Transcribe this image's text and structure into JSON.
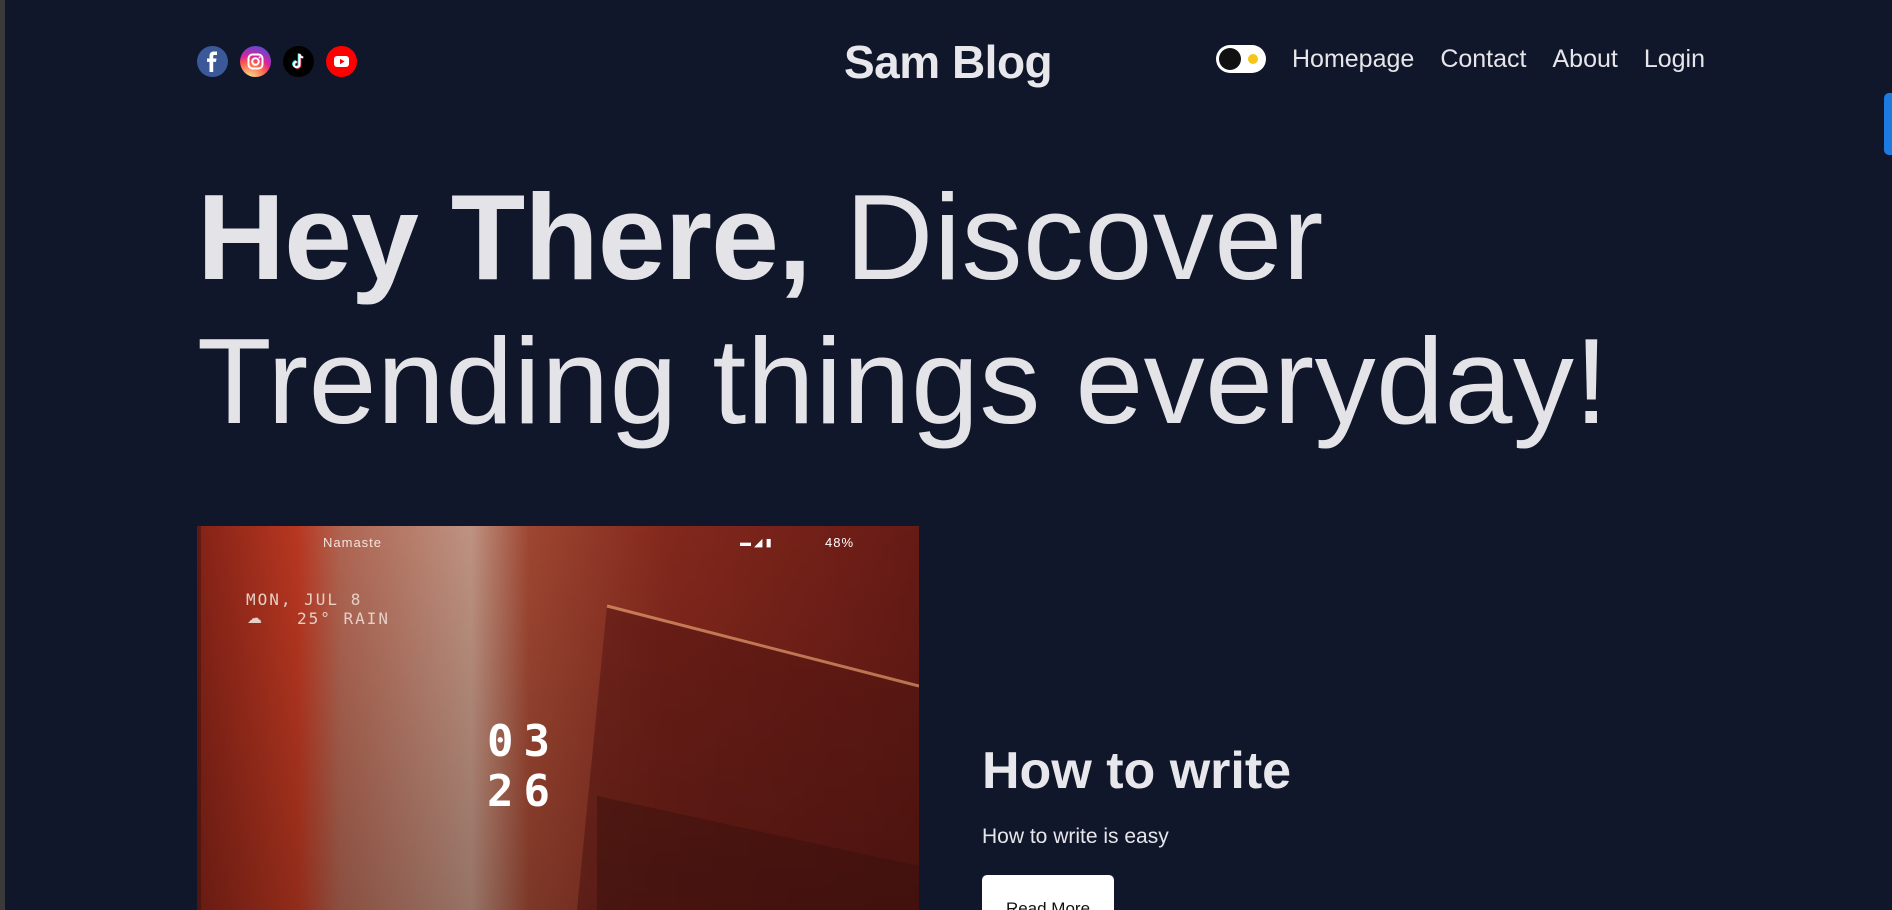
{
  "brand": {
    "title": "Sam Blog"
  },
  "socials": [
    {
      "name": "facebook-icon",
      "color": "#3b5998"
    },
    {
      "name": "instagram-icon",
      "color": "#d6249f"
    },
    {
      "name": "tiktok-icon",
      "color": "#000000"
    },
    {
      "name": "youtube-icon",
      "color": "#ff0000"
    }
  ],
  "nav": {
    "theme_toggle_icon": "sun-icon",
    "links": [
      "Homepage",
      "Contact",
      "About",
      "Login"
    ]
  },
  "hero": {
    "bold": "Hey There,",
    "light": "Discover Trending things everyday!"
  },
  "post": {
    "title": "How to write",
    "description": "How to write is easy",
    "button_label": "Read More",
    "image": {
      "greeting": "Namaste",
      "battery": "48%",
      "date": "MON, JUL 8",
      "weather": "25° RAIN",
      "hour": "03",
      "minute": "26"
    }
  },
  "colors": {
    "background": "#10172a",
    "text": "#e6e6ea",
    "accent": "#1d7ae0"
  }
}
